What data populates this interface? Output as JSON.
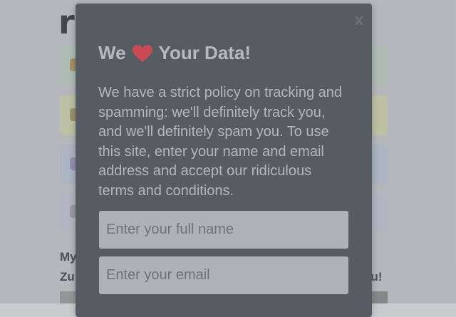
{
  "background": {
    "logo_text": "r",
    "line1": "My",
    "line2": "Zu",
    "line3_tail": "ou!"
  },
  "modal": {
    "title_start": "We",
    "title_icon": "heart-icon",
    "title_end": "Your Data!",
    "close_label": "x",
    "body": "We have a strict policy on tracking and spamming: we'll definitely track you, and we'll definitely spam you. To use this site, enter your name and email address and accept our ridiculous terms and conditions.",
    "name_field": {
      "placeholder": "Enter your full name",
      "value": ""
    },
    "email_field": {
      "placeholder": "Enter your email",
      "value": ""
    }
  },
  "colors": {
    "modal_bg": "#575c63",
    "heart": "#c94a55",
    "input_bg": "#aeb2b8"
  }
}
